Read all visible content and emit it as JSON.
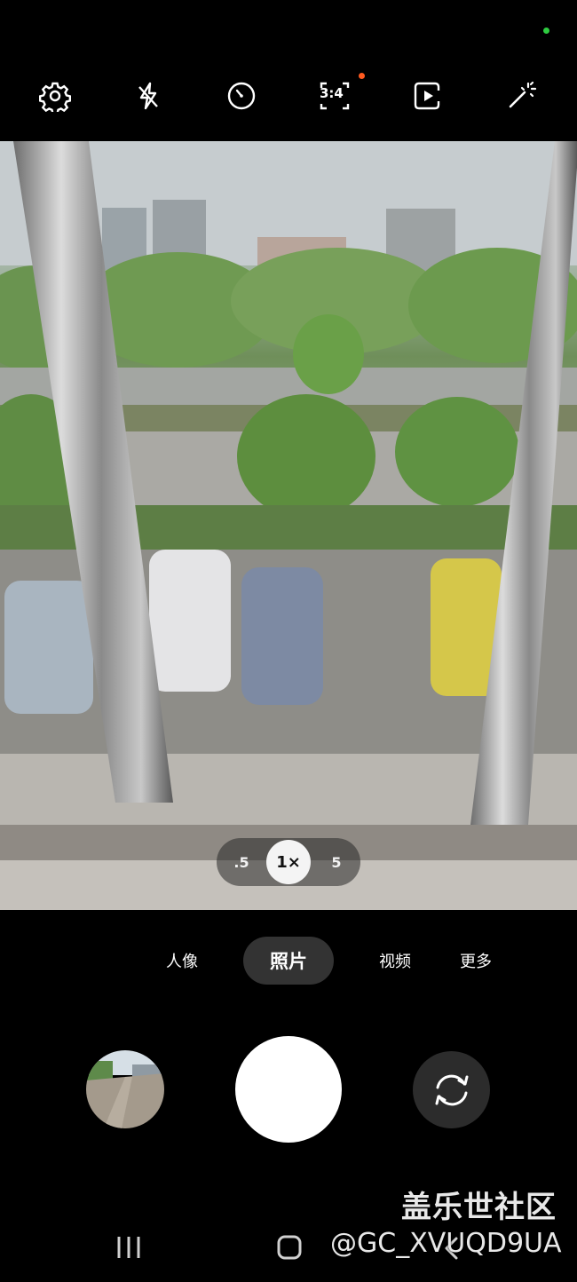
{
  "colors": {
    "status_dot": "#2ecc40",
    "badge_dot": "#ff5a1f",
    "background": "#000000"
  },
  "toolbar": {
    "settings_icon": "gear-icon",
    "flash_icon": "flash-off-icon",
    "timer_icon": "timer-icon",
    "ratio_label": "3:4",
    "motion_icon": "motion-photo-icon",
    "filter_icon": "magic-wand-icon"
  },
  "zoom": {
    "options": [
      ".5",
      "1×",
      "5"
    ],
    "selected": "1×"
  },
  "modes": {
    "portrait": "人像",
    "photo": "照片",
    "video": "视频",
    "more": "更多",
    "selected": "照片"
  },
  "controls": {
    "gallery_icon": "gallery-thumbnail",
    "shutter_icon": "shutter-button",
    "flip_icon": "switch-camera-icon"
  },
  "navbar": {
    "recents_icon": "recents-icon",
    "home_icon": "home-icon",
    "back_icon": "back-icon"
  },
  "watermark": {
    "title": "盖乐世社区",
    "handle": "@GC_XVUQD9UA"
  }
}
